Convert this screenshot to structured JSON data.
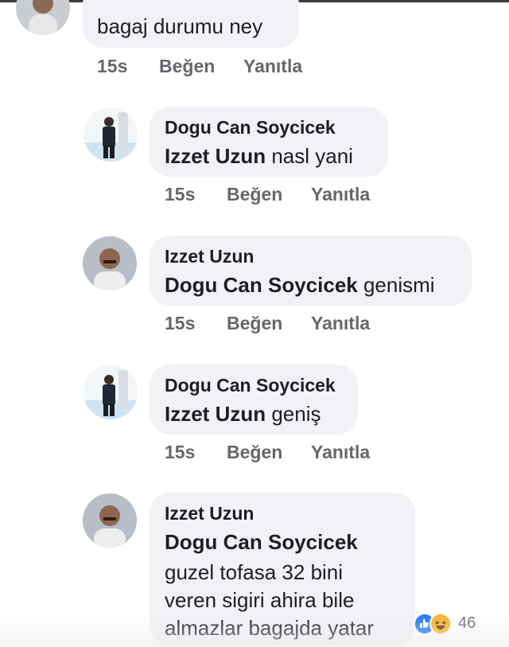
{
  "comments": [
    {
      "author": "",
      "text": "bagaj durumu ney",
      "time": "15s",
      "like": "Beğen",
      "reply": "Yanıtla"
    },
    {
      "author": "Dogu Can Soycicek",
      "mention": "Izzet Uzun",
      "text": " nasl yani",
      "time": "15s",
      "like": "Beğen",
      "reply": "Yanıtla"
    },
    {
      "author": "Izzet Uzun",
      "mention": "Dogu Can Soycicek",
      "text": " genismi",
      "time": "15s",
      "like": "Beğen",
      "reply": "Yanıtla"
    },
    {
      "author": "Dogu Can Soycicek",
      "mention": "Izzet Uzun",
      "text": " geniş",
      "time": "15s",
      "like": "Beğen",
      "reply": "Yanıtla"
    },
    {
      "author": "Izzet Uzun",
      "mention": "Dogu Can Soycicek",
      "lines": [
        "guzel tofasa 32 bini",
        "veren sigiri ahira bile",
        "almazlar bagajda yatar"
      ],
      "reaction_count": "46"
    }
  ],
  "icons": {
    "like_reaction": "like-icon",
    "haha_reaction": "haha-icon"
  },
  "colors": {
    "bubble": "#f0f2f5",
    "meta": "#65676b",
    "like_blue": "#1877f2",
    "haha_yellow": "#f7b125"
  }
}
